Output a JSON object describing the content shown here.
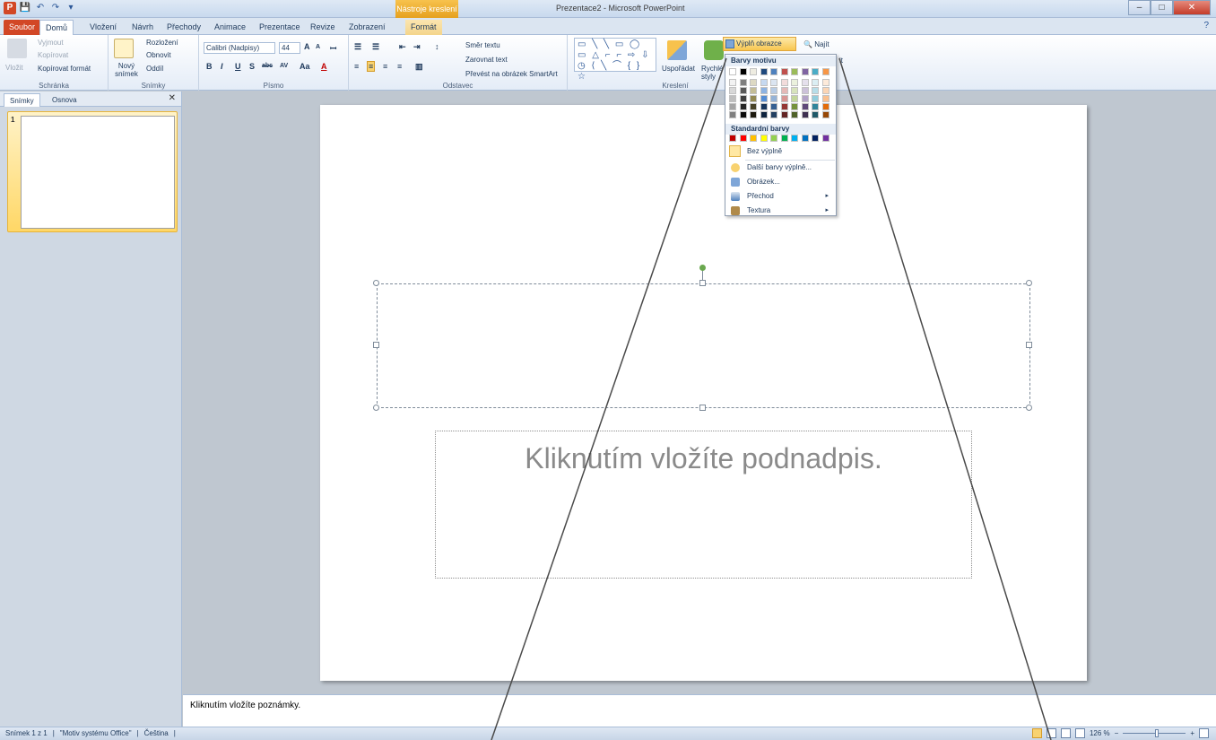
{
  "window": {
    "title": "Prezentace2 - Microsoft PowerPoint",
    "contextual_group": "Nástroje kreslení",
    "controls": {
      "minimize": "–",
      "maximize": "□",
      "close": "✕"
    }
  },
  "qat": {
    "logo": "P",
    "save": "💾",
    "undo": "↶",
    "redo": "↷",
    "customize": "▾"
  },
  "tabs": {
    "file": "Soubor",
    "home": "Domů",
    "insert": "Vložení",
    "design": "Návrh",
    "transitions": "Přechody",
    "animations": "Animace",
    "slideshow": "Prezentace",
    "review": "Revize",
    "view": "Zobrazení",
    "format": "Formát",
    "help": "?"
  },
  "ribbon": {
    "clipboard": {
      "paste": "Vložit",
      "cut": "Vyjmout",
      "copy": "Kopírovat",
      "format_painter": "Kopírovat formát",
      "label": "Schránka"
    },
    "slides": {
      "new_slide": "Nový snímek",
      "layout": "Rozložení",
      "reset": "Obnovit",
      "section": "Oddíl",
      "label": "Snímky"
    },
    "font": {
      "font_name": "Calibri (Nadpisy)",
      "font_size": "44",
      "grow": "A",
      "shrink": "A",
      "clear": "ꟷ",
      "bold": "B",
      "italic": "I",
      "underline": "U",
      "shadow": "S",
      "strike": "abc",
      "spacing": "AV",
      "case": "Aa",
      "color": "A",
      "label": "Písmo"
    },
    "paragraph": {
      "bullets": "☰",
      "numbering": "☰",
      "decrease_indent": "⇤",
      "increase_indent": "⇥",
      "line_spacing": "↕",
      "text_direction": "Směr textu",
      "align_text": "Zarovnat text",
      "convert_smartart": "Převést na obrázek SmartArt",
      "align_left": "≡",
      "center": "≡",
      "align_right": "≡",
      "justify": "≡",
      "columns": "▥",
      "label": "Odstavec"
    },
    "drawing": {
      "shapes": "▭ ╲ ╲ ▭ ◯ ▭ △ ⌐ ⌐ ⇨ ⇩ ◷ ⟨ ╲ ⌒ { } ☆",
      "arrange": "Uspořádat",
      "quick_styles": "Rychlé styly",
      "shape_fill": "Výplň obrazce",
      "label": "Kreslení"
    },
    "editing": {
      "find": "Najít",
      "replace": "it"
    }
  },
  "slides_pane": {
    "tab_slides": "Snímky",
    "tab_outline": "Osnova",
    "close": "✕",
    "thumb_number": "1"
  },
  "slide": {
    "subtitle_placeholder": "Kliknutím vložíte podnadpis."
  },
  "notes": {
    "placeholder": "Kliknutím vložíte poznámky."
  },
  "status": {
    "slide": "Snímek 1 z 1",
    "theme": "\"Motiv systému Office\"",
    "language": "Čeština",
    "zoom": "126 %",
    "zoom_level_percent": 126,
    "zoom_minus": "−",
    "zoom_plus": "+"
  },
  "fill_menu": {
    "theme_colors_heading": "Barvy motivu",
    "standard_colors_heading": "Standardní barvy",
    "no_fill": "Bez výplně",
    "more_colors": "Další barvy výplně...",
    "picture": "Obrázek...",
    "gradient": "Přechod",
    "texture": "Textura",
    "theme_colors": [
      "#ffffff",
      "#000000",
      "#eeece1",
      "#1f497d",
      "#4f81bd",
      "#c0504d",
      "#9bbb59",
      "#8064a2",
      "#4bacc6",
      "#f79646"
    ],
    "theme_shades": [
      [
        "#f2f2f2",
        "#7f7f7f",
        "#ddd9c3",
        "#c6d9f0",
        "#dbe5f1",
        "#f2dcdb",
        "#ebf1dd",
        "#e5e0ec",
        "#dbeef3",
        "#fdeada"
      ],
      [
        "#d8d8d8",
        "#595959",
        "#c4bd97",
        "#8db3e2",
        "#b8cce4",
        "#e5b9b7",
        "#d7e3bc",
        "#ccc1d9",
        "#b7dde8",
        "#fbd5b5"
      ],
      [
        "#bfbfbf",
        "#3f3f3f",
        "#938953",
        "#548dd4",
        "#95b3d7",
        "#d99694",
        "#c3d69b",
        "#b2a2c7",
        "#92cddc",
        "#fac08f"
      ],
      [
        "#a5a5a5",
        "#262626",
        "#494429",
        "#17365d",
        "#366092",
        "#953734",
        "#76923c",
        "#5f497a",
        "#31859b",
        "#e36c09"
      ],
      [
        "#7f7f7f",
        "#0c0c0c",
        "#1d1b10",
        "#0f243e",
        "#244061",
        "#632423",
        "#4f6128",
        "#3f3151",
        "#205867",
        "#974806"
      ]
    ],
    "standard_colors": [
      "#c00000",
      "#ff0000",
      "#ffc000",
      "#ffff00",
      "#92d050",
      "#00b050",
      "#00b0f0",
      "#0070c0",
      "#002060",
      "#7030a0"
    ],
    "submenu_arrow": "▸"
  },
  "colors": {
    "file_tab": "#d24726",
    "contextual": "#f4b63c",
    "annotation_line": "#4a4a4a",
    "rotate_handle": "#6aa84f"
  }
}
